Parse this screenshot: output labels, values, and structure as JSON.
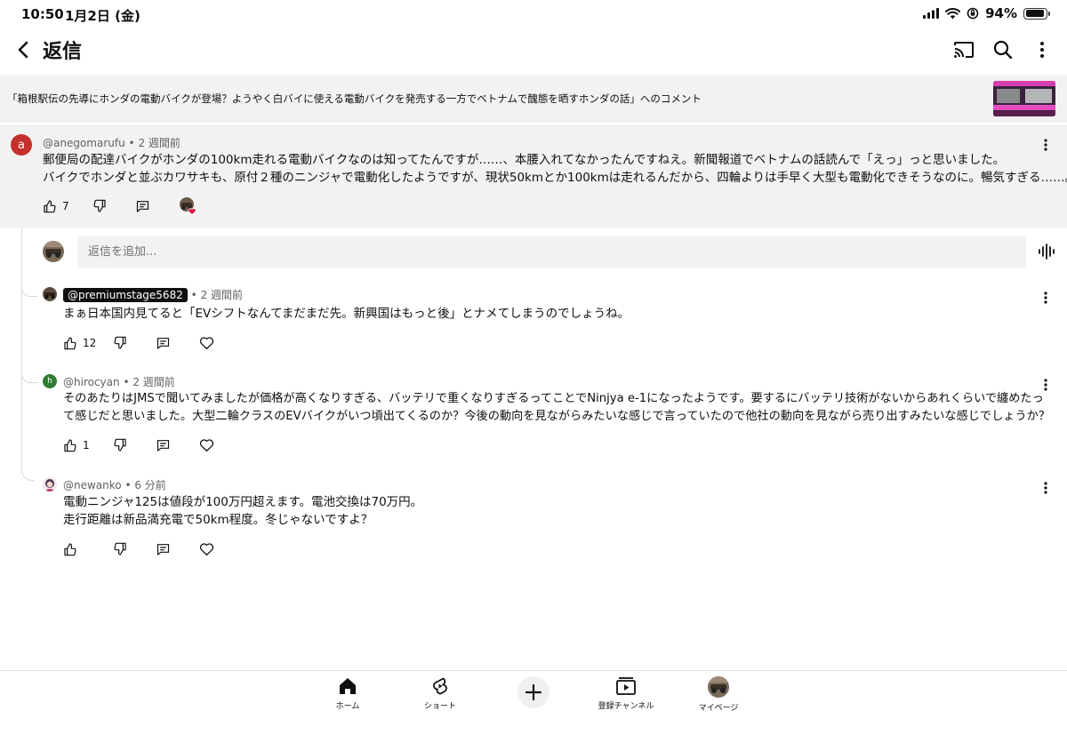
{
  "status_bar": {
    "time": "10:50",
    "date": "1月2日 (金)",
    "battery": "94%",
    "battery_level": 0.94
  },
  "header": {
    "title": "返信"
  },
  "video": {
    "title": "「箱根駅伝の先導にホンダの電動バイクが登場？ようやく白バイに使える電動バイクを発売する一方でベトナムで醜態を晒すホンダの話」へのコメント"
  },
  "parent_comment": {
    "avatar_letter": "a",
    "avatar_color": "#c4302b",
    "author": "@anegomarufu",
    "time": "2 週間前",
    "lines": [
      "郵便局の配達バイクがホンダの100km走れる電動バイクなのは知ってたんですが……、本腰入れてなかったんですねえ。新聞報道でベトナムの話読んで「えっ」っと思いました。",
      "バイクでホンダと並ぶカワサキも、原付２種のニンジャで電動化したようですが、現状50kmとか100kmは走れるんだから、四輪よりは手早く大型も電動化できそうなのに。暢気すぎる……。"
    ],
    "likes": "7"
  },
  "reply_box": {
    "placeholder": "返信を追加..."
  },
  "replies": [
    {
      "author": "@premiumstage5682",
      "time": "2 週間前",
      "lines": [
        "まぁ日本国内見てると「EVシフトなんてまだまだ先。新興国はもっと後」とナメてしまうのでしょうね。"
      ],
      "likes": "12"
    },
    {
      "avatar_letter": "h",
      "avatar_color": "#2e7d32",
      "author": "@hirocyan",
      "time": "2 週間前",
      "lines": [
        "そのあたりはJMSで聞いてみましたが価格が高くなりすぎる、バッテリで重くなりすぎるってことでNinjya e-1になったようです。要するにバッテリ技術がないからあれくらいで纏めたっ",
        "て感じだと思いました。大型二輪クラスのEVバイクがいつ頃出てくるのか？今後の動向を見ながらみたいな感じで言っていたので他社の動向を見ながら売り出すみたいな感じでしょうか？"
      ],
      "likes": "1"
    },
    {
      "author": "@newanko",
      "time": "6 分前",
      "lines": [
        "電動ニンジャ125は値段が100万円超えます。電池交換は70万円。",
        "走行距離は新品満充電で50km程度。冬じゃないですよ？"
      ],
      "likes": ""
    }
  ],
  "bottom_nav": {
    "home": "ホーム",
    "shorts": "ショート",
    "subscriptions": "登録チャンネル",
    "you": "マイページ"
  }
}
